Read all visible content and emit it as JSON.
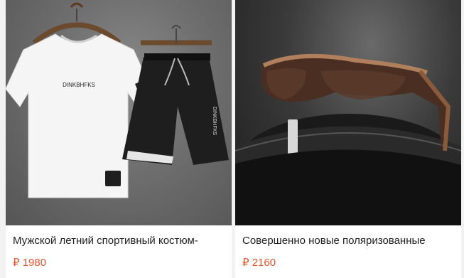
{
  "products": [
    {
      "title": "Мужской летний спортивный костюм-",
      "price": "₽ 1980",
      "image": {
        "shirt_print": "DINKBHFKS",
        "shorts_print": "DINKBHFKS"
      }
    },
    {
      "title": "Совершенно новые поляризованные",
      "price": "₽ 2160"
    }
  ],
  "colors": {
    "price": "#e3542f",
    "title": "#222222",
    "background": "#f2f2f2",
    "card": "#ffffff"
  }
}
